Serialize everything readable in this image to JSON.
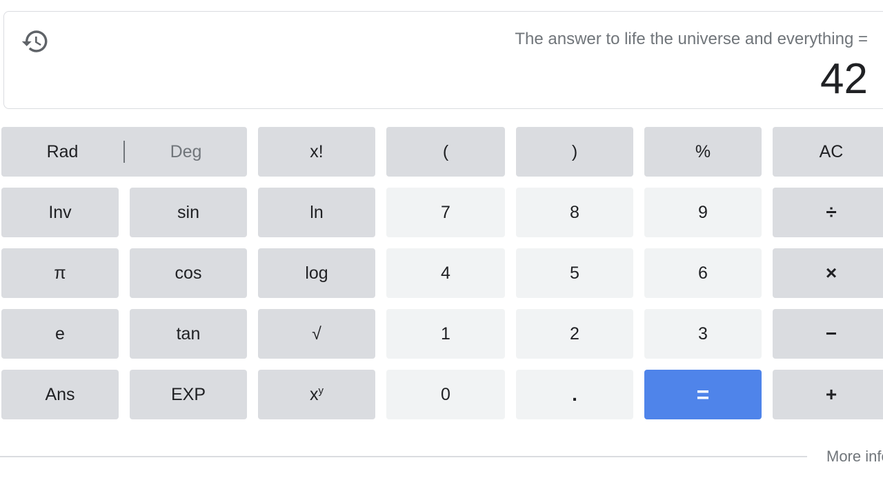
{
  "display": {
    "history_icon": "history-icon",
    "expression": "The answer to life the universe and everything =",
    "result": "42"
  },
  "mode": {
    "rad_label": "Rad",
    "deg_label": "Deg",
    "selected": "Rad"
  },
  "keys": {
    "factorial": "x!",
    "open_paren": "(",
    "close_paren": ")",
    "percent": "%",
    "clear": "AC",
    "inv": "Inv",
    "sin": "sin",
    "ln": "ln",
    "seven": "7",
    "eight": "8",
    "nine": "9",
    "divide": "÷",
    "pi": "π",
    "cos": "cos",
    "log": "log",
    "four": "4",
    "five": "5",
    "six": "6",
    "multiply": "×",
    "e": "e",
    "tan": "tan",
    "sqrt": "√",
    "one": "1",
    "two": "2",
    "three": "3",
    "minus": "−",
    "ans": "Ans",
    "exp": "EXP",
    "power_base": "x",
    "power_exp": "y",
    "zero": "0",
    "decimal": ".",
    "equals": "=",
    "plus": "+"
  },
  "footer": {
    "more_info": "More info"
  },
  "colors": {
    "function_key": "#dadce0",
    "digit_key": "#f1f3f4",
    "equals_key": "#4f84ea",
    "muted_text": "#70757a"
  }
}
